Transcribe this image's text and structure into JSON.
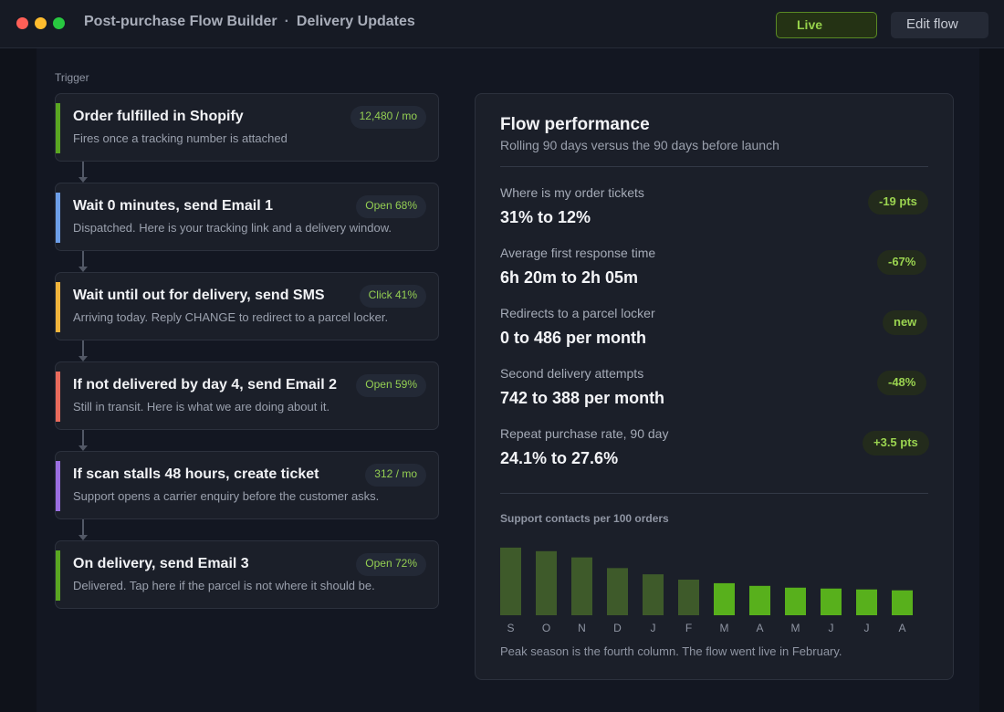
{
  "window": {
    "title": "Post-purchase Flow Builder",
    "separator": "·",
    "subtitle": "Delivery Updates",
    "live_button": "Live",
    "edit_button": "Edit flow"
  },
  "flow": {
    "trigger_label": "Trigger",
    "steps": [
      {
        "title": "Order fulfilled in Shopify",
        "subtitle": "Fires once a tracking number is attached",
        "badge": "12,480 / mo",
        "accent": "#5aa622"
      },
      {
        "title": "Wait 0 minutes, send Email 1",
        "subtitle": "Dispatched. Here is your tracking link and a delivery window.",
        "badge": "Open 68%",
        "accent": "#6c9ee8"
      },
      {
        "title": "Wait until out for delivery, send SMS",
        "subtitle": "Arriving today. Reply CHANGE to redirect to a parcel locker.",
        "badge": "Click 41%",
        "accent": "#f0b43c"
      },
      {
        "title": "If not delivered by day 4, send Email 2",
        "subtitle": "Still in transit. Here is what we are doing about it.",
        "badge": "Open 59%",
        "accent": "#e86a5c"
      },
      {
        "title": "If scan stalls 48 hours, create ticket",
        "subtitle": "Support opens a carrier enquiry before the customer asks.",
        "badge": "312 / mo",
        "accent": "#9a6ee0"
      },
      {
        "title": "On delivery, send Email 3",
        "subtitle": "Delivered. Tap here if the parcel is not where it should be.",
        "badge": "Open 72%",
        "accent": "#5aa622"
      }
    ]
  },
  "performance": {
    "title": "Flow performance",
    "subtitle": "Rolling 90 days versus the 90 days before launch",
    "metrics": [
      {
        "label": "Where is my order tickets",
        "value": "31% to 12%",
        "badge": "-19 pts"
      },
      {
        "label": "Average first response time",
        "value": "6h 20m to 2h 05m",
        "badge": "-67%"
      },
      {
        "label": "Redirects to a parcel locker",
        "value": "0 to 486 per month",
        "badge": "new"
      },
      {
        "label": "Second delivery attempts",
        "value": "742 to 388 per month",
        "badge": "-48%"
      },
      {
        "label": "Repeat purchase rate, 90 day",
        "value": "24.1% to 27.6%",
        "badge": "+3.5 pts"
      }
    ],
    "chart_title": "Support contacts per 100 orders",
    "chart_note": "Peak season is the fourth column. The flow went live in February."
  },
  "colors": {
    "before_launch": "#3e5a2a",
    "after_launch": "#58b01c",
    "accent_green": "#96d14a"
  },
  "chart_data": {
    "type": "bar",
    "title": "Support contacts per 100 orders",
    "categories": [
      "S",
      "O",
      "N",
      "D",
      "J",
      "F",
      "M",
      "A",
      "M",
      "J",
      "J",
      "A"
    ],
    "values": [
      7.6,
      7.2,
      6.5,
      5.3,
      4.6,
      4.0,
      3.6,
      3.3,
      3.1,
      3.0,
      2.9,
      2.8
    ],
    "launch_index": 6,
    "ylim": [
      0,
      8
    ],
    "grid": false,
    "xlabel": "",
    "ylabel": ""
  }
}
